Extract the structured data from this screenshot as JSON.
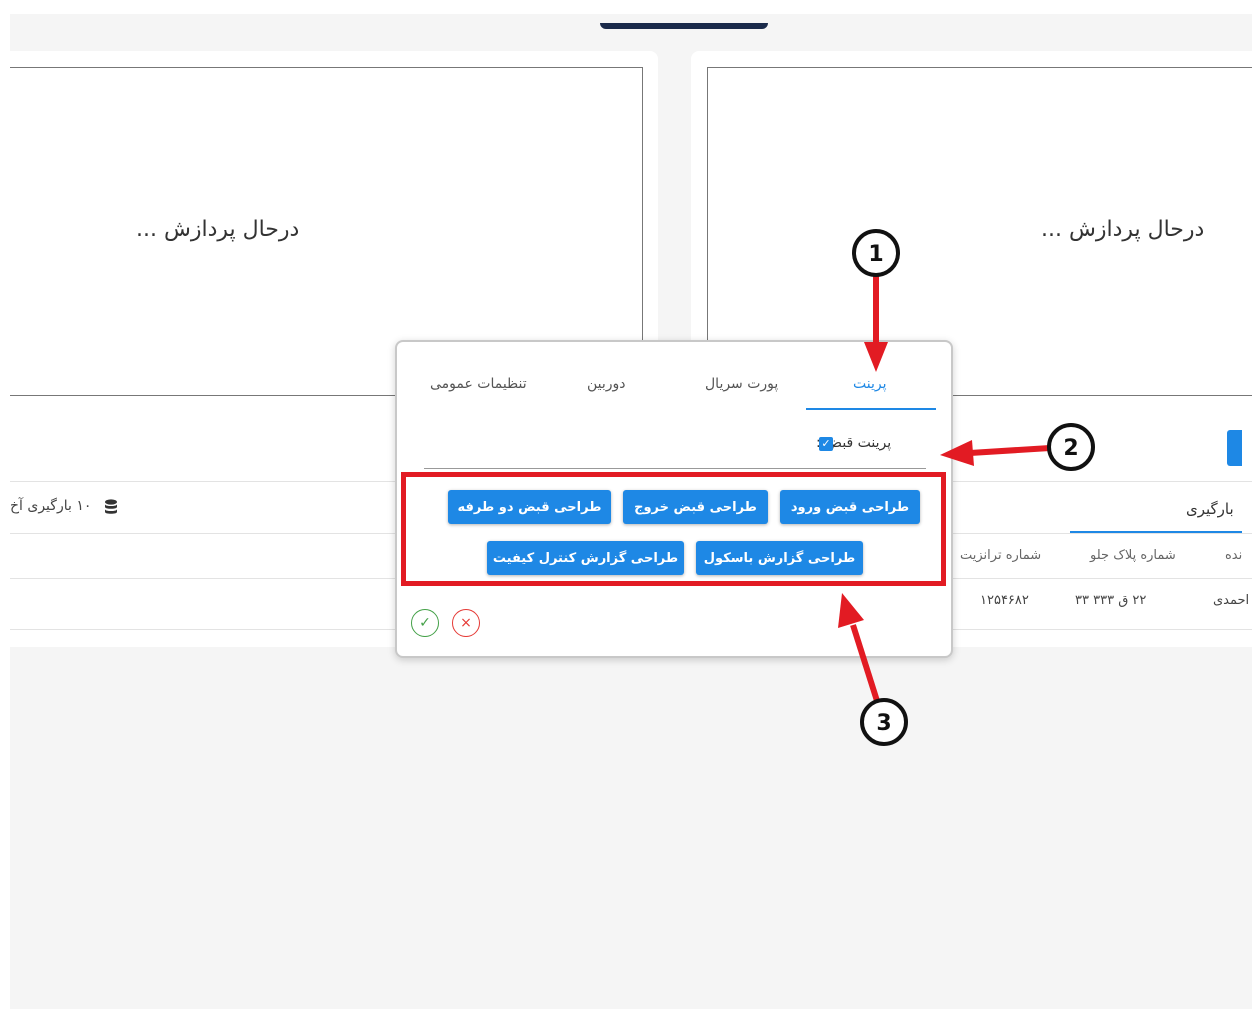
{
  "camera_panels": {
    "left_status": "درحال پردازش ...",
    "right_status": "درحال پردازش ..."
  },
  "background": {
    "db_info": "۱۰ بارگیری آخ",
    "loading_tab": "بارگیری",
    "columns": {
      "transit_number": "شماره ترانزیت",
      "front_plate": "شماره پلاک جلو",
      "driver": "نده"
    },
    "row": {
      "transit_number": "۱۲۵۴۶۸۲",
      "front_plate": "۲۲ ق ۳۳۳ ۳۳",
      "driver": "احمدی"
    }
  },
  "dialog": {
    "tabs": {
      "print": "پرینت",
      "serial_port": "پورت سریال",
      "camera": "دوربین",
      "general_settings": "تنظیمات عمومی"
    },
    "print_receipt_label": "پرینت قبض :",
    "print_receipt_checked": true,
    "buttons": {
      "entry_receipt": "طراحی قبض ورود",
      "exit_receipt": "طراحی قبض خروج",
      "two_way_receipt": "طراحی قبض دو طرفه",
      "scale_report": "طراحی گزارش باسکول",
      "qc_report": "طراحی گزارش کنترل کیفیت"
    },
    "ok_symbol": "✓",
    "cancel_symbol": "×"
  },
  "annotations": {
    "one": "1",
    "two": "2",
    "three": "3"
  },
  "colors": {
    "accent": "#1e88e5",
    "annotation_red": "#e21b23",
    "ok": "#43a047",
    "cancel": "#e53935"
  }
}
